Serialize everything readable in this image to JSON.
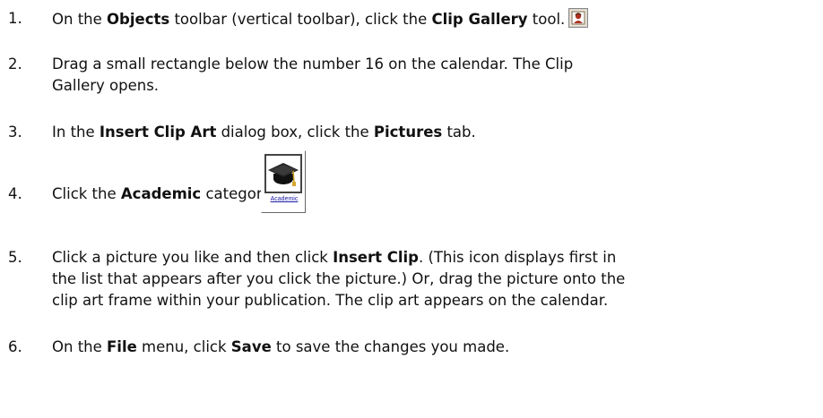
{
  "steps": [
    {
      "number": "1.",
      "parts": [
        "On the ",
        "Objects",
        " toolbar (vertical toolbar), click the ",
        "Clip Gallery",
        " tool."
      ],
      "icon": "clip-gallery-icon"
    },
    {
      "number": "2.",
      "lines": [
        "Drag a small rectangle below the number 16 on the calendar. The Clip",
        "Gallery opens."
      ]
    },
    {
      "number": "3.",
      "parts": [
        "In the ",
        "Insert Clip Art",
        " dialog box, click the ",
        "Pictures",
        " tab."
      ]
    },
    {
      "number": "4.",
      "parts": [
        "Click the ",
        "Academic",
        " category."
      ],
      "icon": "graduation-cap-icon",
      "icon_label": "Academic"
    },
    {
      "number": "5.",
      "line1_parts": [
        "Click a picture you like and then click ",
        "Insert Clip",
        ". (This icon displays first in"
      ],
      "lines": [
        "the list that appears after you click the picture.) Or, drag the picture onto the",
        "clip art frame within your publication. The clip art appears on the calendar."
      ]
    },
    {
      "number": "6.",
      "parts": [
        "On the ",
        "File",
        " menu, click ",
        "Save",
        " to save the changes you made."
      ]
    }
  ]
}
